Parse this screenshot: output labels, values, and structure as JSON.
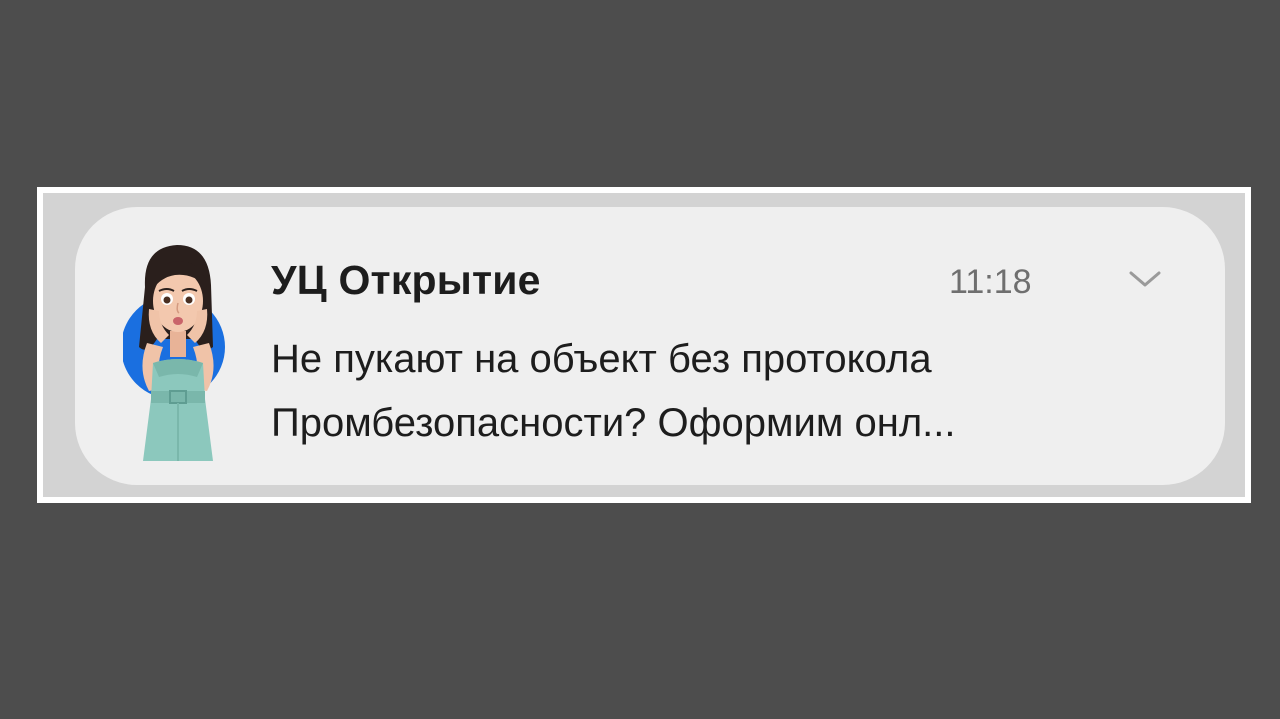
{
  "notification": {
    "sender": "УЦ Открытие",
    "time": "11:18",
    "message_lines": [
      "Не пукают на объект без протокола",
      "Промбезопасности? Оформим онл..."
    ],
    "avatar_icon": "memoji-woman-avatar-icon",
    "expand_icon": "chevron-down-icon"
  },
  "colors": {
    "page_background": "#4d4d4d",
    "frame_border": "#ffffff",
    "card_background": "#efefef",
    "avatar_circle": "#1a6fe0",
    "dress": "#8cc8bd"
  }
}
